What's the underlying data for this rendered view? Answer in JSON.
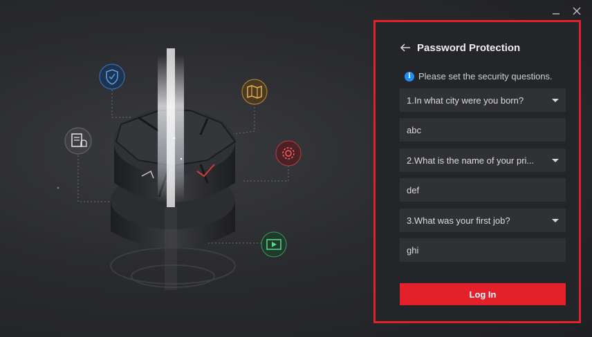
{
  "window": {
    "minimize_icon": "minimize-icon",
    "close_icon": "close-icon"
  },
  "panel": {
    "title": "Password Protection",
    "hint": "Please set the security questions.",
    "info_symbol": "i",
    "questions": [
      {
        "question": "1.In what city were you born?",
        "answer": "abc"
      },
      {
        "question": "2.What is the name of your pri...",
        "answer": "def"
      },
      {
        "question": "3.What was your first job?",
        "answer": "ghi"
      }
    ],
    "login_label": "Log In"
  },
  "colors": {
    "accent": "#e3212b",
    "info": "#1e8ef0",
    "panel_bg": "#242528",
    "field_bg": "#303134"
  }
}
